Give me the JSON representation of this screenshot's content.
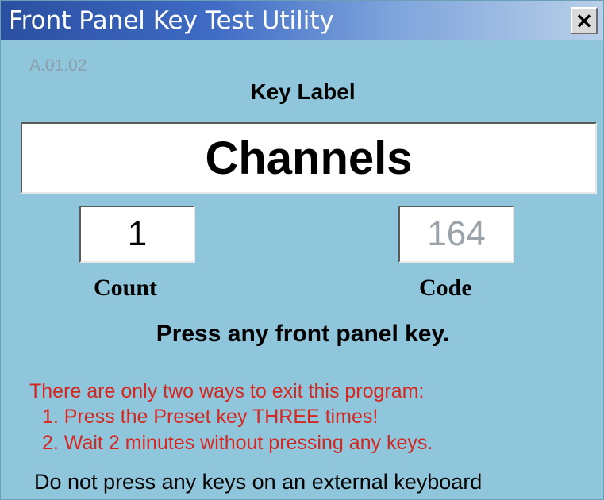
{
  "window": {
    "title": "Front Panel Key Test Utility",
    "close_label": "×",
    "version": "A.01.02"
  },
  "key_label": {
    "heading": "Key Label",
    "value": "Channels"
  },
  "count": {
    "value": "1",
    "label": "Count"
  },
  "code": {
    "value": "164",
    "label": "Code"
  },
  "instruction": "Press any front panel key.",
  "warnings": [
    "There are only two ways to exit this program:",
    "1. Press the Preset key THREE times!",
    "2. Wait 2 minutes without pressing any keys."
  ],
  "footer": "Do not press any keys on an external keyboard",
  "colors": {
    "background": "#8fc6dc",
    "title_gradient_start": "#2a4fa0",
    "warning_text": "#d6261f",
    "disabled_text": "#9aa3aa"
  }
}
